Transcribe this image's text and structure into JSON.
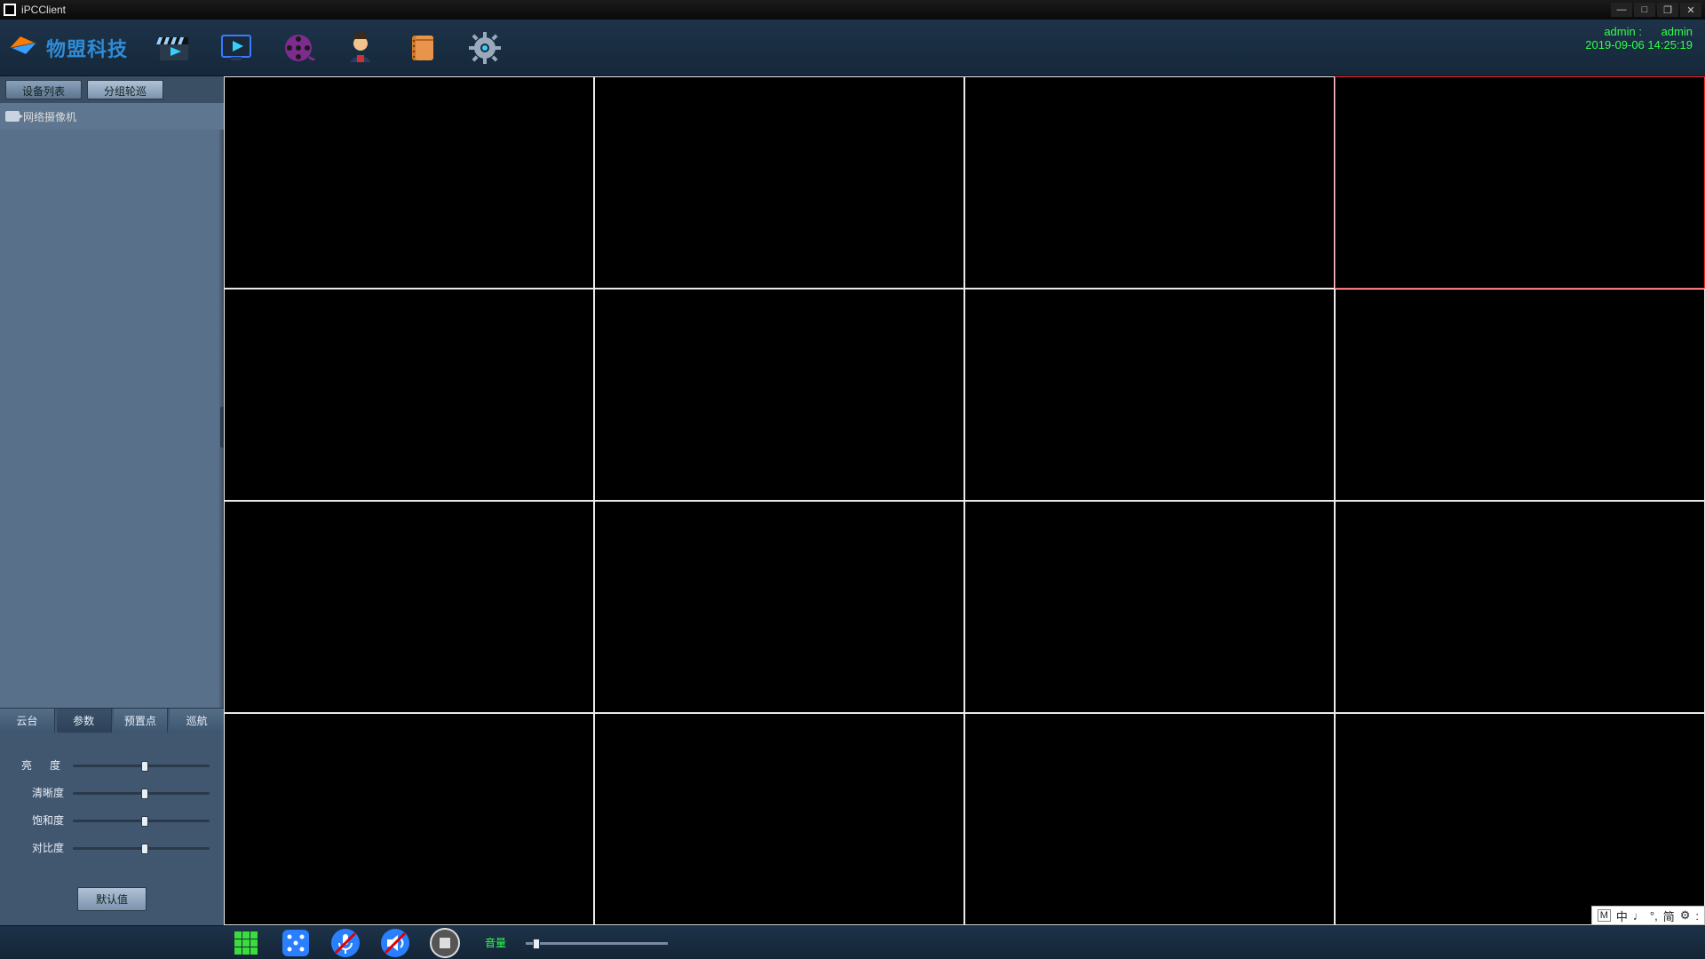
{
  "window": {
    "title": "iPCClient"
  },
  "brand": {
    "name": "物盟科技"
  },
  "toolbar": {
    "items": [
      {
        "name": "clapper-icon"
      },
      {
        "name": "play-monitor-icon"
      },
      {
        "name": "film-reel-icon"
      },
      {
        "name": "user-support-icon"
      },
      {
        "name": "notebook-icon"
      },
      {
        "name": "settings-gear-icon"
      }
    ]
  },
  "user": {
    "label": "admin :",
    "value": "admin",
    "datetime": "2019-09-06 14:25:19"
  },
  "sidebar": {
    "tabs": [
      {
        "label": "设备列表",
        "active": true
      },
      {
        "label": "分组轮巡",
        "active": false
      }
    ],
    "tree": {
      "root": "网络摄像机"
    },
    "lower_tabs": [
      {
        "label": "云台"
      },
      {
        "label": "参数",
        "active": true
      },
      {
        "label": "预置点"
      },
      {
        "label": "巡航"
      }
    ],
    "params": {
      "brightness": {
        "label": "亮　度",
        "value": 50
      },
      "sharpness": {
        "label": "清晰度",
        "value": 50
      },
      "saturation": {
        "label": "饱和度",
        "value": 50
      },
      "contrast": {
        "label": "对比度",
        "value": 50
      },
      "default_button": "默认值"
    }
  },
  "grid": {
    "rows": 4,
    "cols": 4,
    "selected_index": 3
  },
  "bottombar": {
    "volume_label": "音量",
    "volume_value": 5
  },
  "ime": {
    "items": [
      "M",
      "中",
      "♩",
      "°,",
      "简",
      "⚙",
      ":"
    ]
  }
}
